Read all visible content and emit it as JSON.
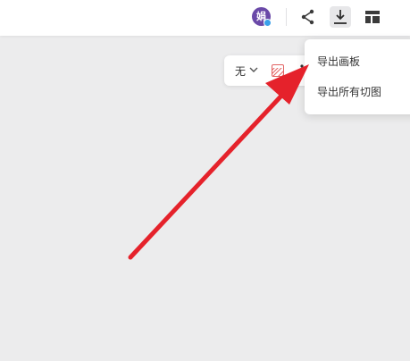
{
  "header": {
    "avatar_text": "娟",
    "icons": [
      "share-icon",
      "download-icon",
      "layout-icon"
    ]
  },
  "properties_panel": {
    "fill_value": "无",
    "icons": [
      "chevron-down-icon",
      "no-fill-swatch-icon",
      "more-icon"
    ]
  },
  "export_menu": {
    "items": [
      {
        "label": "导出画板"
      },
      {
        "label": "导出所有切图"
      }
    ]
  },
  "colors": {
    "canvas": "#ececed",
    "avatar": "#6a49a8",
    "annotation_arrow": "#e5222b"
  }
}
